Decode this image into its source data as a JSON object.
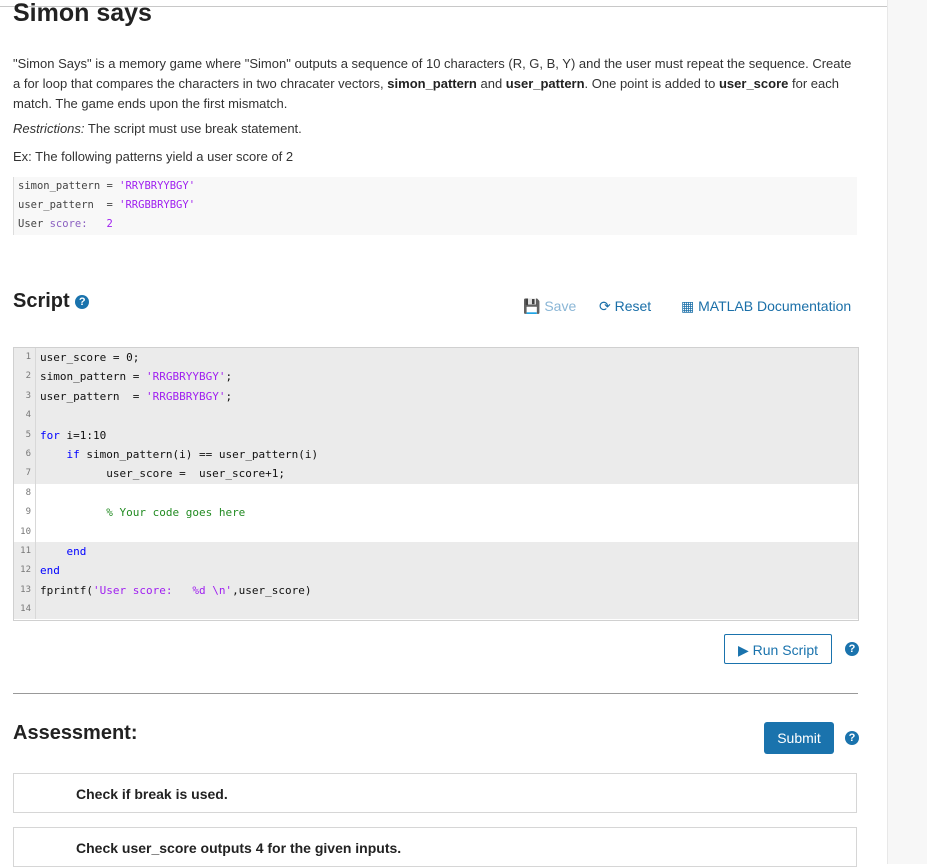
{
  "title": "Simon says",
  "description": {
    "p1": "\"Simon Says\" is a memory game where \"Simon\" outputs a sequence of 10 characters (R, G, B, Y) and the user must repeat the sequence. Create a for loop that compares the characters in two chracater vectors, ",
    "b1": "simon_pattern",
    "p2": " and ",
    "b2": "user_pattern",
    "p3": ". One point is added to ",
    "b3": "user_score",
    "p4": " for each match. The game ends upon the first mismatch."
  },
  "restrictions": {
    "label": "Restrictions:",
    "text": " The script must use break statement."
  },
  "example_intro": "Ex: The following patterns yield a user score of 2",
  "example": {
    "l1_a": "simon_pattern = ",
    "l1_b": "'RRYBRYYBGY'",
    "l2_a": "user_pattern  = ",
    "l2_b": "'RRGBBRYBGY'",
    "l3_a": "User ",
    "l3_b": "score:",
    "l3_c": "   2"
  },
  "script_header": "Script",
  "toolbar": {
    "save": "Save",
    "reset": "Reset",
    "docs": "MATLAB Documentation"
  },
  "editor": {
    "lines": [
      {
        "n": "1",
        "a": "user_score = 0;"
      },
      {
        "n": "2",
        "a": "simon_pattern = ",
        "s": "'RRGBRYYBGY'",
        "b": ";"
      },
      {
        "n": "3",
        "a": "user_pattern  = ",
        "s": "'RRGBBRYBGY'",
        "b": ";"
      },
      {
        "n": "4",
        "a": ""
      },
      {
        "n": "5",
        "k": "for",
        "a": " i=1:10"
      },
      {
        "n": "6",
        "p": "    ",
        "k": "if",
        "a": " simon_pattern(i) == user_pattern(i)"
      },
      {
        "n": "7",
        "a": "          user_score =  user_score+1;"
      },
      {
        "n": "8",
        "a": ""
      },
      {
        "n": "9",
        "p": "          ",
        "c": "% Your code goes here"
      },
      {
        "n": "10",
        "a": ""
      },
      {
        "n": "11",
        "p": "    ",
        "k": "end"
      },
      {
        "n": "12",
        "k": "end"
      },
      {
        "n": "13",
        "a": "fprintf(",
        "s": "'User score:   %d \\n'",
        "b": ",user_score)"
      },
      {
        "n": "14",
        "a": ""
      }
    ]
  },
  "run_label": "Run Script",
  "assessment_header": "Assessment:",
  "submit_label": "Submit",
  "help_glyph": "?",
  "checks": [
    "Check if break is used.",
    "Check user_score outputs 4 for the given inputs."
  ],
  "colors": {
    "accent": "#1a73ad",
    "string": "#a020f0",
    "keyword": "#0000ff",
    "comment": "#228b22"
  }
}
